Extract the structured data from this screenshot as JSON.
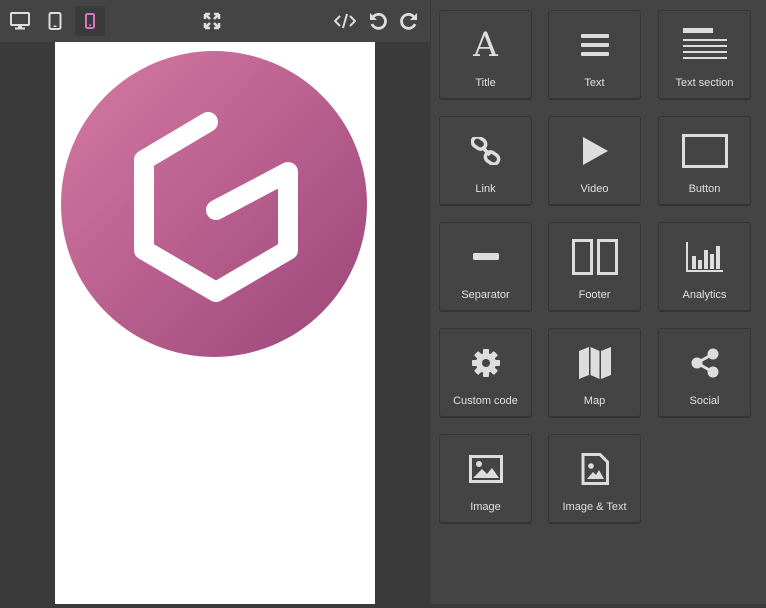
{
  "toolbar": {
    "devices": [
      {
        "name": "desktop",
        "icon": "desktop-icon",
        "active": false
      },
      {
        "name": "tablet",
        "icon": "tablet-icon",
        "active": false
      },
      {
        "name": "mobile",
        "icon": "mobile-icon",
        "active": true
      }
    ],
    "actions": [
      {
        "name": "fullscreen",
        "icon": "fullscreen-icon"
      },
      {
        "name": "code",
        "icon": "code-icon"
      },
      {
        "name": "undo",
        "icon": "undo-icon"
      },
      {
        "name": "redo",
        "icon": "redo-icon"
      }
    ],
    "active_color": "#d278c9"
  },
  "canvas": {
    "logo": {
      "icon": "g-hexagon-logo-icon",
      "gradient_start": "#d67aa3",
      "gradient_end": "#9e4a7a"
    }
  },
  "blocks": {
    "title": "Title",
    "text": "Text",
    "text_section": "Text section",
    "link": "Link",
    "video": "Video",
    "button": "Button",
    "separator": "Separator",
    "footer": "Footer",
    "analytics": "Analytics",
    "custom_code": "Custom code",
    "map": "Map",
    "social": "Social",
    "image": "Image",
    "image_text": "Image & Text",
    "title_glyph": "A"
  }
}
